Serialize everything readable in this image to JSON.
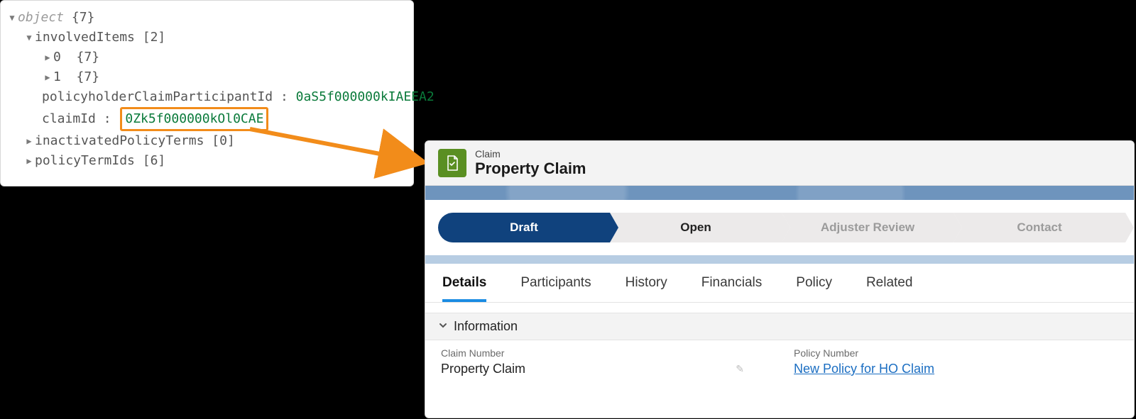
{
  "json": {
    "root_label": "object",
    "root_count": "{7}",
    "involvedItems_label": "involvedItems",
    "involvedItems_count": "[2]",
    "item0_idx": "0",
    "item0_count": "{7}",
    "item1_idx": "1",
    "item1_count": "{7}",
    "policyholder_key": "policyholderClaimParticipantId",
    "policyholder_val": "0aS5f000000kIAEEA2",
    "claimId_key": "claimId",
    "claimId_val": "0Zk5f000000kOl0CAE",
    "inactivated_key": "inactivatedPolicyTerms",
    "inactivated_count": "[0]",
    "policyTermIds_key": "policyTermIds",
    "policyTermIds_count": "[6]"
  },
  "record": {
    "object_label": "Claim",
    "title": "Property Claim",
    "stages": {
      "s1": "Draft",
      "s2": "Open",
      "s3": "Adjuster Review",
      "s4": "Contact"
    },
    "tabs": {
      "t1": "Details",
      "t2": "Participants",
      "t3": "History",
      "t4": "Financials",
      "t5": "Policy",
      "t6": "Related"
    },
    "section": "Information",
    "fields": {
      "claim_no_label": "Claim Number",
      "claim_no_value": "Property Claim",
      "policy_no_label": "Policy Number",
      "policy_no_value": "New Policy for HO Claim"
    }
  }
}
